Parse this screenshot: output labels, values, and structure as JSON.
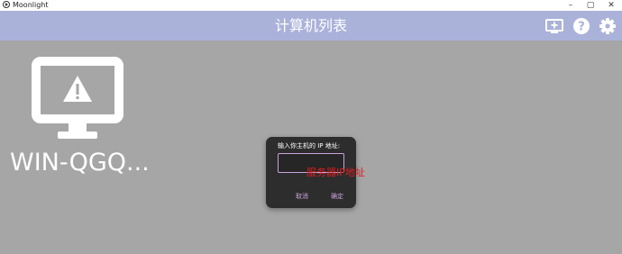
{
  "window": {
    "title": "Moonlight"
  },
  "header": {
    "title": "计算机列表"
  },
  "computer": {
    "name": "WIN-QGQ..."
  },
  "dialog": {
    "title": "输入你主机的 IP 地址:",
    "input_value": "",
    "cancel_label": "取消",
    "ok_label": "确定"
  },
  "annotation": {
    "text": "服务器IP地址"
  },
  "colors": {
    "header_bg": "#aab2da",
    "content_bg": "#a6a6a6",
    "dialog_bg": "#2d2d2d",
    "accent": "#c9a3dc",
    "annotation": "#e01e1e"
  },
  "icons": {
    "app": "moonlight-logo-icon",
    "add_host": "add-pc-icon",
    "help": "help-icon",
    "settings": "gear-icon",
    "computer": "computer-warning-icon"
  }
}
